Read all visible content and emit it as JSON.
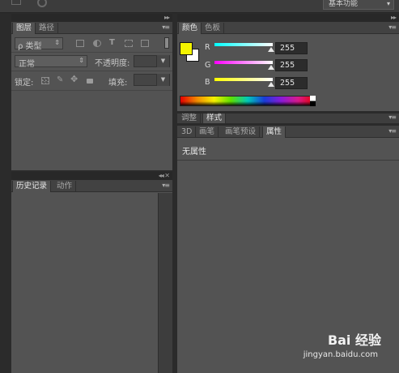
{
  "topbar": {
    "workspace_label": "基本功能"
  },
  "collapse_glyph": "▸▸",
  "panel_menu_glyph": "▾≡",
  "layers_panel": {
    "tabs": [
      "图层",
      "路径"
    ],
    "kind_filter": "ρ 类型",
    "filter_icons": [
      "image-filter-icon",
      "adjustment-filter-icon",
      "type-filter-icon",
      "shape-filter-icon",
      "smart-object-filter-icon"
    ],
    "blend_mode": "正常",
    "opacity_label": "不透明度:",
    "opacity_value": "",
    "lock_label": "锁定:",
    "lock_icons": [
      "lock-transparent-icon",
      "lock-image-icon",
      "lock-position-icon",
      "lock-all-icon"
    ],
    "fill_label": "填充:",
    "fill_value": ""
  },
  "history_panel": {
    "tabs": [
      "历史记录",
      "动作"
    ]
  },
  "color_panel": {
    "tabs": [
      "颜色",
      "色板"
    ],
    "foreground_color": "#f5f500",
    "background_color": "#ffffff",
    "channels": [
      {
        "label": "R",
        "value": "255"
      },
      {
        "label": "G",
        "value": "255"
      },
      {
        "label": "B",
        "value": "255"
      }
    ]
  },
  "adjust_panel": {
    "tabs": [
      "调整",
      "样式"
    ]
  },
  "properties_panel": {
    "tabs": [
      "3D",
      "画笔",
      "画笔预设",
      "属性"
    ],
    "empty_text": "无属性"
  },
  "watermark": {
    "brand": "Bai 经验",
    "url": "jingyan.baidu.com"
  }
}
